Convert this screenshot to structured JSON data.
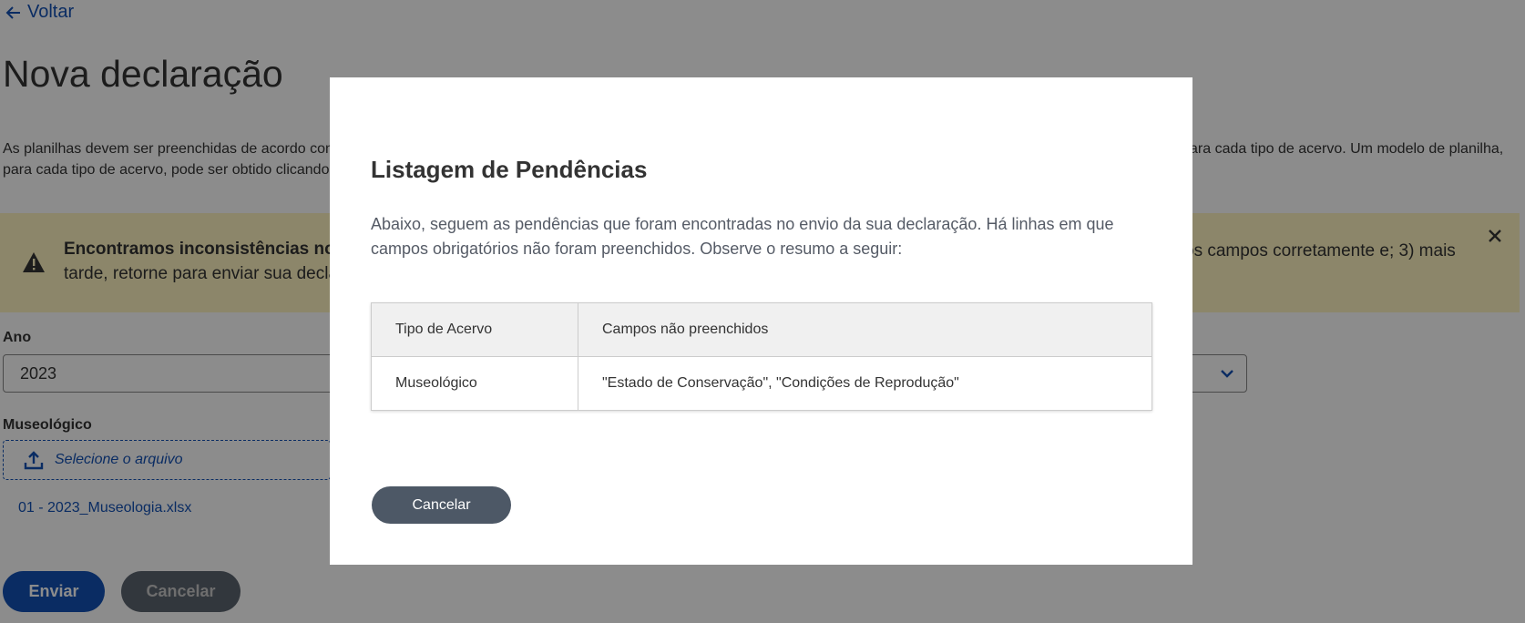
{
  "back_link": {
    "label": "Voltar"
  },
  "page_title": "Nova declaração",
  "intro": {
    "line1_start": "As planilhas devem ser preenchidas de acordo com",
    "line1_end": "ara cada tipo de acervo. Um modelo de planilha,",
    "line2": "para cada tipo de acervo, pode ser obtido clicando"
  },
  "alert": {
    "bold_start": "Encontramos inconsistências no",
    "line1_end": "os campos corretamente e; 3) mais",
    "line2": "tarde, retorne para enviar sua decla"
  },
  "form": {
    "year_label": "Ano",
    "year_value": "2023",
    "museologico_label": "Museológico",
    "upload_placeholder": "Selecione o arquivo",
    "file_name": "01 - 2023_Museologia.xlsx"
  },
  "actions": {
    "send_label": "Enviar",
    "cancel_label": "Cancelar"
  },
  "modal": {
    "title": "Listagem de Pendências",
    "description": "Abaixo, seguem as pendências que foram encontradas no envio da sua declaração. Há linhas em que campos obrigatórios não foram preenchidos. Observe o resumo a seguir:",
    "table": {
      "headers": [
        "Tipo de Acervo",
        "Campos não preenchidos"
      ],
      "rows": [
        [
          "Museológico",
          "\"Estado de Conservação\", \"Condições de Reprodução\""
        ]
      ]
    },
    "cancel_label": "Cancelar"
  },
  "colors": {
    "primary": "#1351b4",
    "alert_bg": "#fff5c2",
    "modal_button": "#4d5866"
  },
  "icons": [
    "arrow-left-icon",
    "warning-icon",
    "close-icon",
    "chevron-down-icon",
    "upload-icon"
  ]
}
